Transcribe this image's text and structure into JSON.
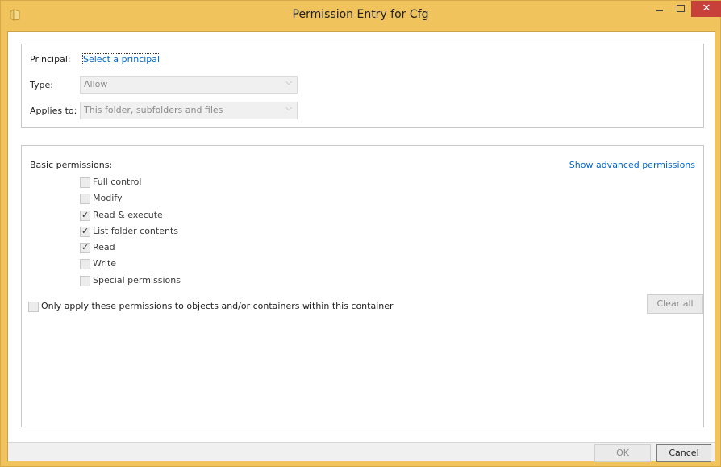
{
  "window": {
    "title": "Permission Entry for Cfg",
    "icon": "folder-icon",
    "controls": {
      "minimize": "minimize-icon",
      "maximize": "maximize-icon",
      "close": "close-icon",
      "close_glyph": "✕"
    }
  },
  "principal": {
    "label": "Principal:",
    "link": "Select a principal"
  },
  "type": {
    "label": "Type:",
    "value": "Allow"
  },
  "applies_to": {
    "label": "Applies to:",
    "value": "This folder, subfolders and files"
  },
  "basic_permissions": {
    "label": "Basic permissions:",
    "show_advanced": "Show advanced permissions",
    "items": [
      {
        "label": "Full control",
        "checked": false
      },
      {
        "label": "Modify",
        "checked": false
      },
      {
        "label": "Read & execute",
        "checked": true
      },
      {
        "label": "List folder contents",
        "checked": true
      },
      {
        "label": "Read",
        "checked": true
      },
      {
        "label": "Write",
        "checked": false
      },
      {
        "label": "Special permissions",
        "checked": false
      }
    ]
  },
  "only_apply": {
    "label": "Only apply these permissions to objects and/or containers within this container",
    "checked": false
  },
  "buttons": {
    "clear_all": "Clear all",
    "ok": "OK",
    "cancel": "Cancel"
  },
  "colors": {
    "title_bar": "#f0c35c",
    "close_button": "#c7403a",
    "link": "#0066cc"
  }
}
